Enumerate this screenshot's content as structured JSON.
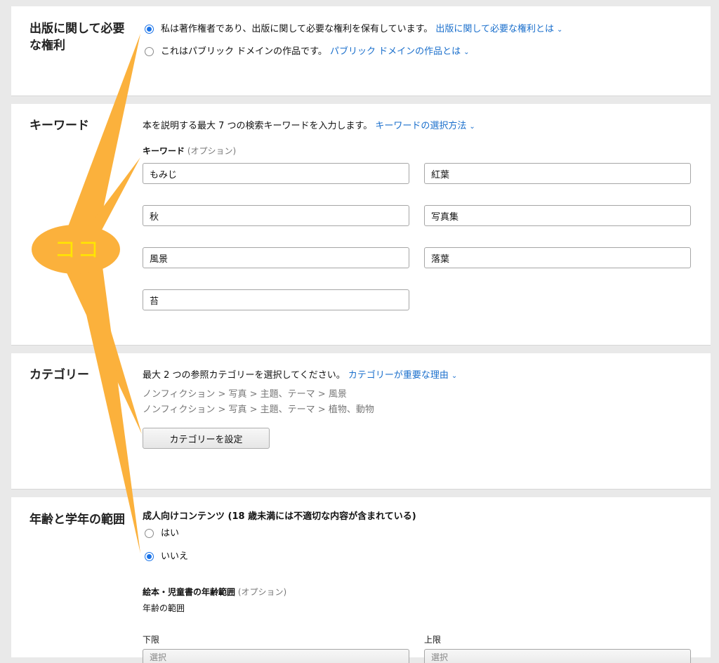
{
  "publishing_rights": {
    "title": "出版に関して必要な権利",
    "option_owner": "私は著作権者であり、出版に関して必要な権利を保有しています。",
    "option_owner_link": "出版に関して必要な権利とは",
    "option_public": "これはパブリック ドメインの作品です。",
    "option_public_link": "パブリック ドメインの作品とは",
    "selected": "owner"
  },
  "keywords": {
    "title": "キーワード",
    "description": "本を説明する最大 7 つの検索キーワードを入力します。",
    "help_link": "キーワードの選択方法",
    "field_label": "キーワード",
    "field_optional": "(オプション)",
    "values": [
      "もみじ",
      "紅葉",
      "秋",
      "写真集",
      "風景",
      "落葉",
      "苔"
    ]
  },
  "categories": {
    "title": "カテゴリー",
    "description": "最大 2 つの参照カテゴリーを選択してください。",
    "help_link": "カテゴリーが重要な理由",
    "selected": [
      "ノンフィクション > 写真 > 主題、テーマ > 風景",
      "ノンフィクション > 写真 > 主題、テーマ > 植物、動物"
    ],
    "set_button": "カテゴリーを設定"
  },
  "age_range": {
    "title": "年齢と学年の範囲",
    "adult_label": "成人向けコンテンツ (18 歳未満には不適切な内容が含まれている)",
    "yes": "はい",
    "no": "いいえ",
    "selected": "no",
    "children_label": "絵本・児童書の年齢範囲",
    "children_optional": "(オプション)",
    "range_label": "年齢の範囲",
    "min_label": "下限",
    "max_label": "上限",
    "min_value": "選択",
    "max_value": "選択"
  },
  "annotation": {
    "callout_text": "ココ",
    "color": "#fbb13c",
    "text_color": "#ffe600"
  }
}
